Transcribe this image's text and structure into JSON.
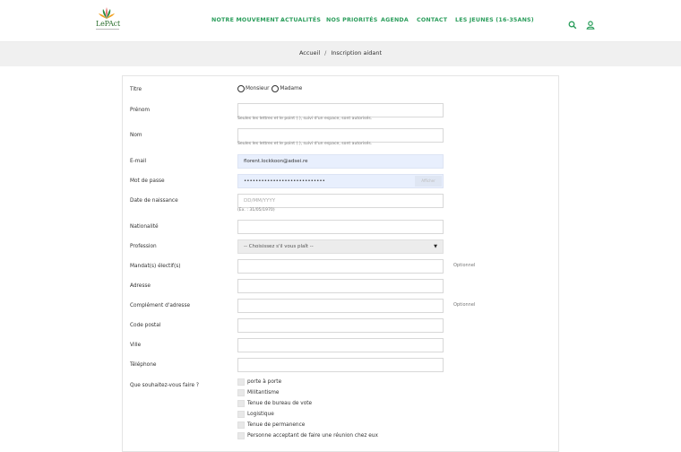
{
  "header": {
    "logo_text": "LePAct",
    "nav": [
      {
        "label": "NOTRE MOUVEMENT",
        "has_caret": true
      },
      {
        "label": "ACTUALITÉS"
      },
      {
        "label": "NOS PRIORITÉS"
      },
      {
        "label": "AGENDA"
      },
      {
        "label": "CONTACT"
      },
      {
        "label": "LES JEUNES (16-35ANS)"
      }
    ],
    "icons": [
      "search-icon",
      "user-icon"
    ],
    "accent_color": "#2a9d5b"
  },
  "breadcrumb": {
    "home": "Accueil",
    "separator": "/",
    "current": "Inscription aidant"
  },
  "form": {
    "titre": {
      "label": "Titre",
      "options": [
        "Monsieur",
        "Madame"
      ]
    },
    "prenom": {
      "label": "Prénom",
      "value": "",
      "hint": "Seules les lettres et le point (.), suivi d'un espace, sont autorisés."
    },
    "nom": {
      "label": "Nom",
      "value": "",
      "hint": "Seules les lettres et le point (.), suivi d'un espace, sont autorisés."
    },
    "email": {
      "label": "E-mail",
      "value": "florent.lockkoon@adsei.re"
    },
    "password": {
      "label": "Mot de passe",
      "value": "••••••••••••••••••••••••••••",
      "show_label": "Afficher"
    },
    "birthdate": {
      "label": "Date de naissance",
      "placeholder": "DD/MM/YYYY",
      "hint": "(Ex. : 31/05/1970)"
    },
    "nationalite": {
      "label": "Nationalité",
      "value": ""
    },
    "profession": {
      "label": "Profession",
      "selected": "-- Choisissez s'il vous plaît --"
    },
    "mandat": {
      "label": "Mandat(s) électif(s)",
      "value": "",
      "optional": "Optionnel"
    },
    "adresse": {
      "label": "Adresse",
      "value": ""
    },
    "complement": {
      "label": "Complément d'adresse",
      "value": "",
      "optional": "Optionnel"
    },
    "code_postal": {
      "label": "Code postal",
      "value": ""
    },
    "ville": {
      "label": "Ville",
      "value": ""
    },
    "telephone": {
      "label": "Téléphone",
      "value": ""
    },
    "souhaits": {
      "label": "Que souhaitez-vous faire ?",
      "options": [
        "porte à porte",
        "Militantisme",
        "Tenue de bureau de vote",
        "Logistique",
        "Tenue de permanence",
        "Personne acceptant de faire une réunion chez eux"
      ]
    }
  }
}
